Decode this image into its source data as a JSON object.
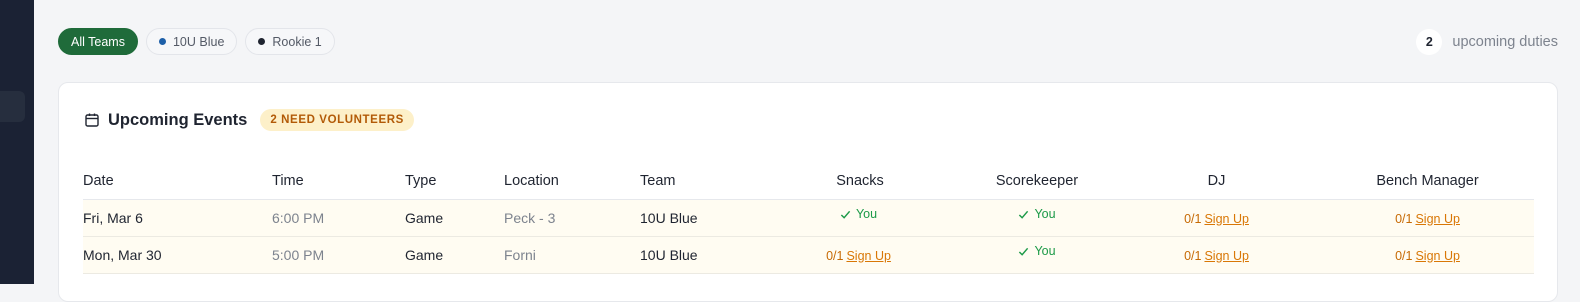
{
  "filters": [
    {
      "label": "All Teams",
      "active": true,
      "dot_color": null
    },
    {
      "label": "10U Blue",
      "active": false,
      "dot_color": "#1d5fa8"
    },
    {
      "label": "Rookie 1",
      "active": false,
      "dot_color": "#1f2430"
    }
  ],
  "summary": {
    "count": "2",
    "label": "upcoming duties"
  },
  "card": {
    "title": "Upcoming Events",
    "badge": "2 NEED VOLUNTEERS"
  },
  "table": {
    "columns": [
      "Date",
      "Time",
      "Type",
      "Location",
      "Team",
      "Snacks",
      "Scorekeeper",
      "DJ",
      "Bench Manager"
    ],
    "rows": [
      {
        "date": "Fri, Mar 6",
        "time": "6:00 PM",
        "type": "Game",
        "location": "Peck - 3",
        "team": "10U Blue",
        "snacks": {
          "status": "you",
          "text": "You"
        },
        "scorekeeper": {
          "status": "you",
          "text": "You"
        },
        "dj": {
          "status": "open",
          "fraction": "0/1",
          "action": "Sign Up"
        },
        "bench": {
          "status": "open",
          "fraction": "0/1",
          "action": "Sign Up"
        }
      },
      {
        "date": "Mon, Mar 30",
        "time": "5:00 PM",
        "type": "Game",
        "location": "Forni",
        "team": "10U Blue",
        "snacks": {
          "status": "open",
          "fraction": "0/1",
          "action": "Sign Up"
        },
        "scorekeeper": {
          "status": "you",
          "text": "You"
        },
        "dj": {
          "status": "open",
          "fraction": "0/1",
          "action": "Sign Up"
        },
        "bench": {
          "status": "open",
          "fraction": "0/1",
          "action": "Sign Up"
        }
      }
    ]
  },
  "colors": {
    "accent": "#1f6b3a",
    "warning": "#d97706",
    "success": "#1c9a48",
    "sidebar": "#1b2234"
  }
}
